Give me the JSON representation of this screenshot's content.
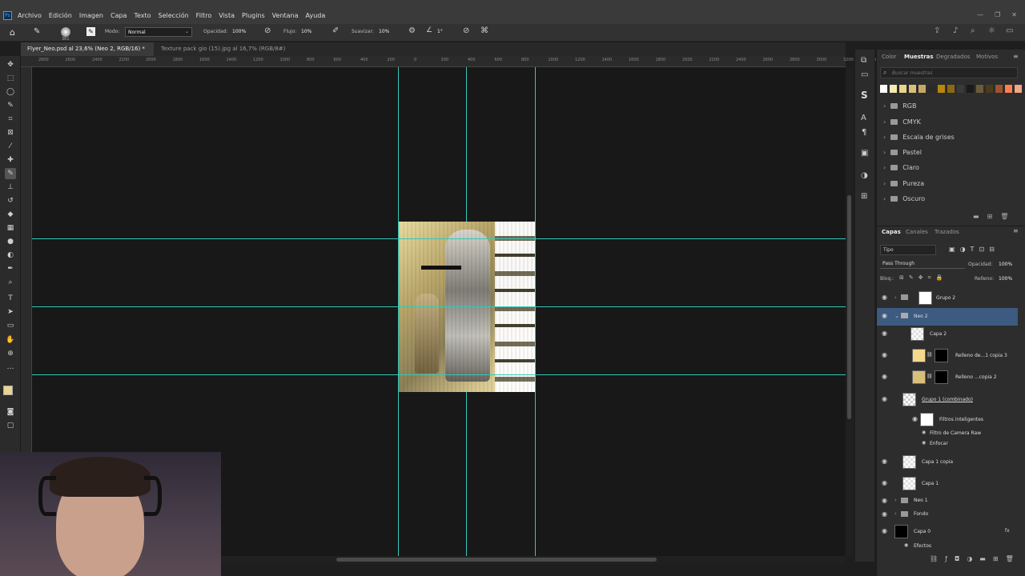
{
  "app": {
    "logo": "Ps"
  },
  "menu": [
    "Archivo",
    "Edición",
    "Imagen",
    "Capa",
    "Texto",
    "Selección",
    "Filtro",
    "Vista",
    "Plugins",
    "Ventana",
    "Ayuda"
  ],
  "options": {
    "brush_size": "361",
    "mode_label": "Modo:",
    "mode_value": "Normal",
    "opacity_label": "Opacidad:",
    "opacity_value": "100%",
    "flow_label": "Flujo:",
    "flow_value": "10%",
    "smooth_label": "Suavizar:",
    "smooth_value": "10%",
    "angle_value": "1°"
  },
  "tabs": [
    {
      "label": "Flyer_Neo.psd al 23,6% (Neo 2, RGB/16) *",
      "active": true
    },
    {
      "label": "Texture pack gio (15).jpg al 16,7% (RGB/8#)",
      "active": false
    }
  ],
  "ruler": [
    "2800",
    "2600",
    "2400",
    "2200",
    "2000",
    "1800",
    "1600",
    "1400",
    "1200",
    "1000",
    "800",
    "600",
    "400",
    "200",
    "0",
    "200",
    "400",
    "600",
    "800",
    "1000",
    "1200",
    "1400",
    "1600",
    "1800",
    "2000",
    "2200",
    "2400",
    "2600",
    "2800",
    "3000",
    "3200",
    "3400"
  ],
  "swatch_panel": {
    "tabs": [
      "Color",
      "Muestras",
      "Degradados",
      "Motivos"
    ],
    "active_tab": "Muestras",
    "search_placeholder": "Buscar muestras",
    "colors": [
      "#ffffff",
      "#f6eab4",
      "#e8d48c",
      "#d9c07a",
      "#c8a864",
      "#2a2a2a",
      "#b8860b",
      "#8b6914",
      "#3a3a3a",
      "#1a1a1a",
      "#6b5b3a",
      "#4a3c20",
      "#a0522d",
      "#ff7f50",
      "#f4a582"
    ],
    "folders": [
      "RGB",
      "CMYK",
      "Escala de grises",
      "Pastel",
      "Claro",
      "Pureza",
      "Oscuro"
    ]
  },
  "layers_panel": {
    "tabs": [
      "Capas",
      "Canales",
      "Trazados"
    ],
    "active_tab": "Capas",
    "filter_label": "Tipo",
    "blend_mode": "Pass Through",
    "opacity_label": "Opacidad:",
    "opacity_value": "100%",
    "lock_label": "Bloq.:",
    "fill_label": "Relleno:",
    "fill_value": "100%",
    "layers": [
      {
        "name": "Grupo 2",
        "kind": "group",
        "thumb": "#ffffff"
      },
      {
        "name": "Neo 2",
        "kind": "group-open",
        "selected": true
      },
      {
        "name": "Capa 2",
        "kind": "layer",
        "thumb": "#ffffff"
      },
      {
        "name": "Relleno de...1 copia 3",
        "kind": "fill",
        "thumb": "#f4d98c"
      },
      {
        "name": "Relleno ...copia 2",
        "kind": "fill",
        "thumb": "#d9c07a"
      },
      {
        "name": "Grupo 1 (combinado)",
        "kind": "smart",
        "thumb": "#ffffff"
      },
      {
        "name": "Filtros inteligentes",
        "kind": "sub",
        "thumb": "#ffffff"
      },
      {
        "name": "Filtro de Camera Raw",
        "kind": "subsub"
      },
      {
        "name": "Enfocar",
        "kind": "subsub"
      },
      {
        "name": "Capa 1 copia",
        "kind": "layer",
        "thumb": "#eeeeee"
      },
      {
        "name": "Capa 1",
        "kind": "layer",
        "thumb": "#eeeeee"
      },
      {
        "name": "Neo 1",
        "kind": "group"
      },
      {
        "name": "Fondo",
        "kind": "group"
      },
      {
        "name": "Capa 0",
        "kind": "layer",
        "thumb": "#000000"
      },
      {
        "name": "Efectos",
        "kind": "subsub"
      }
    ]
  },
  "icons": {
    "home": "home-icon",
    "brush": "brush-icon",
    "search": "search-icon"
  }
}
